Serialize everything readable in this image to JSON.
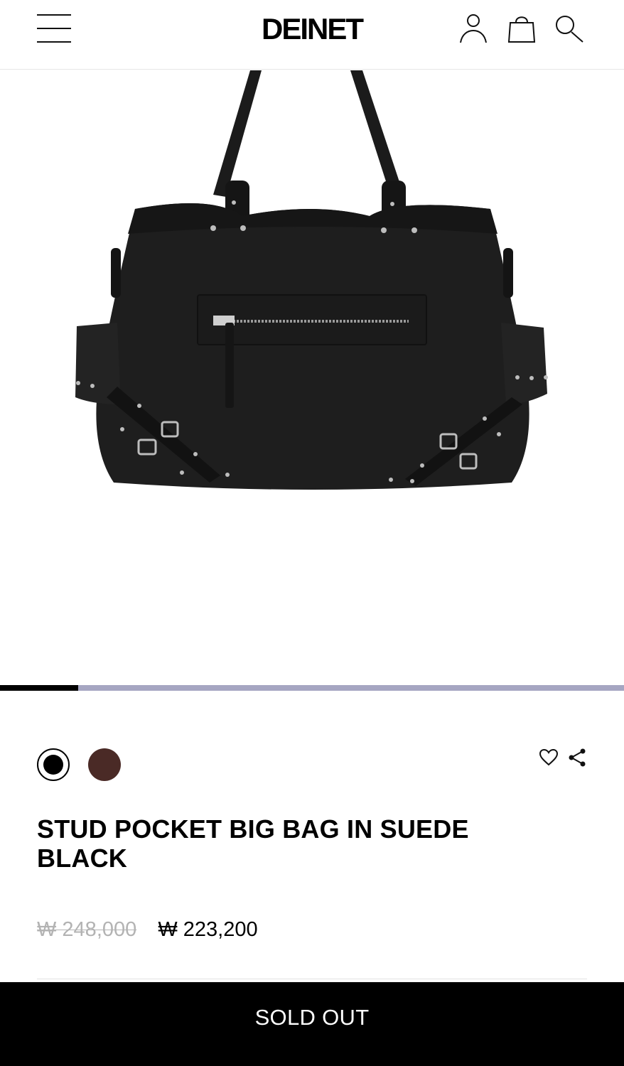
{
  "header": {
    "logo": "DEINET",
    "icons": [
      "menu-icon",
      "user-icon",
      "shopping-bag-icon",
      "search-icon"
    ]
  },
  "gallery": {
    "image": "black suede stud pocket shoulder bag",
    "progress": 0.125,
    "progress_color": "#a6a6c2"
  },
  "colors": {
    "options": [
      {
        "name": "black",
        "hex": "#000000",
        "selected": true
      },
      {
        "name": "brown",
        "hex": "#4a2a26",
        "selected": false
      }
    ]
  },
  "actions": {
    "icons": [
      "heart-icon",
      "share-icon"
    ]
  },
  "product": {
    "title_line1": "STUD POCKET BIG BAG IN SUEDE",
    "title_line2": "BLACK",
    "original_price": "₩ 248,000",
    "sale_price": "₩ 223,200"
  },
  "cta": {
    "label": "SOLD OUT"
  }
}
